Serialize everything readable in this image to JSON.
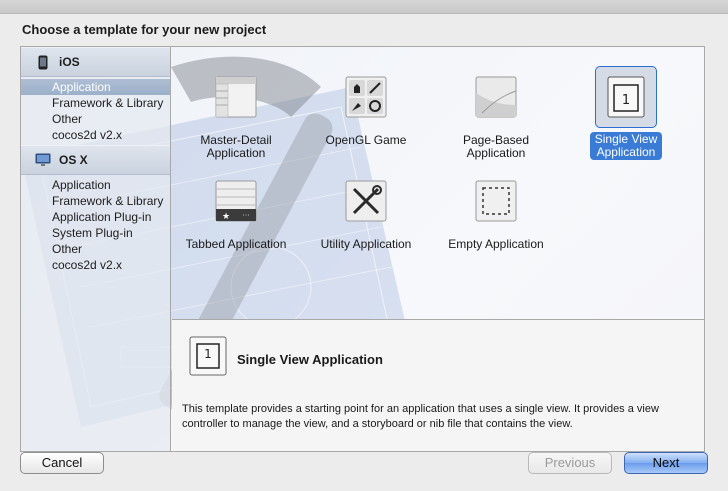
{
  "dialog": {
    "heading": "Choose a template for your new project"
  },
  "sidebar": {
    "groups": [
      {
        "title": "iOS",
        "icon": "iphone-icon",
        "items": [
          "Application",
          "Framework & Library",
          "Other",
          "cocos2d v2.x"
        ],
        "selected_index": 0
      },
      {
        "title": "OS X",
        "icon": "mac-icon",
        "items": [
          "Application",
          "Framework & Library",
          "Application Plug-in",
          "System Plug-in",
          "Other",
          "cocos2d v2.x"
        ]
      }
    ]
  },
  "templates": [
    {
      "label_line1": "Master-Detail",
      "label_line2": "Application",
      "icon": "master-detail-icon"
    },
    {
      "label_line1": "OpenGL Game",
      "label_line2": "",
      "icon": "opengl-game-icon"
    },
    {
      "label_line1": "Page-Based",
      "label_line2": "Application",
      "icon": "page-based-icon"
    },
    {
      "label_line1": "Single View",
      "label_line2": "Application",
      "icon": "single-view-icon",
      "selected": true
    },
    {
      "label_line1": "Tabbed Application",
      "label_line2": "",
      "icon": "tabbed-icon"
    },
    {
      "label_line1": "Utility Application",
      "label_line2": "",
      "icon": "utility-icon"
    },
    {
      "label_line1": "Empty Application",
      "label_line2": "",
      "icon": "empty-icon"
    }
  ],
  "description": {
    "title": "Single View Application",
    "icon_number": "1",
    "text": "This template provides a starting point for an application that uses a single view. It provides a view controller to manage the view, and a storyboard or nib file that contains the view."
  },
  "buttons": {
    "cancel": "Cancel",
    "previous": "Previous",
    "next": "Next"
  },
  "colors": {
    "selection_blue": "#3a7bd5",
    "sidebar_selection": "#9cb0ca"
  }
}
